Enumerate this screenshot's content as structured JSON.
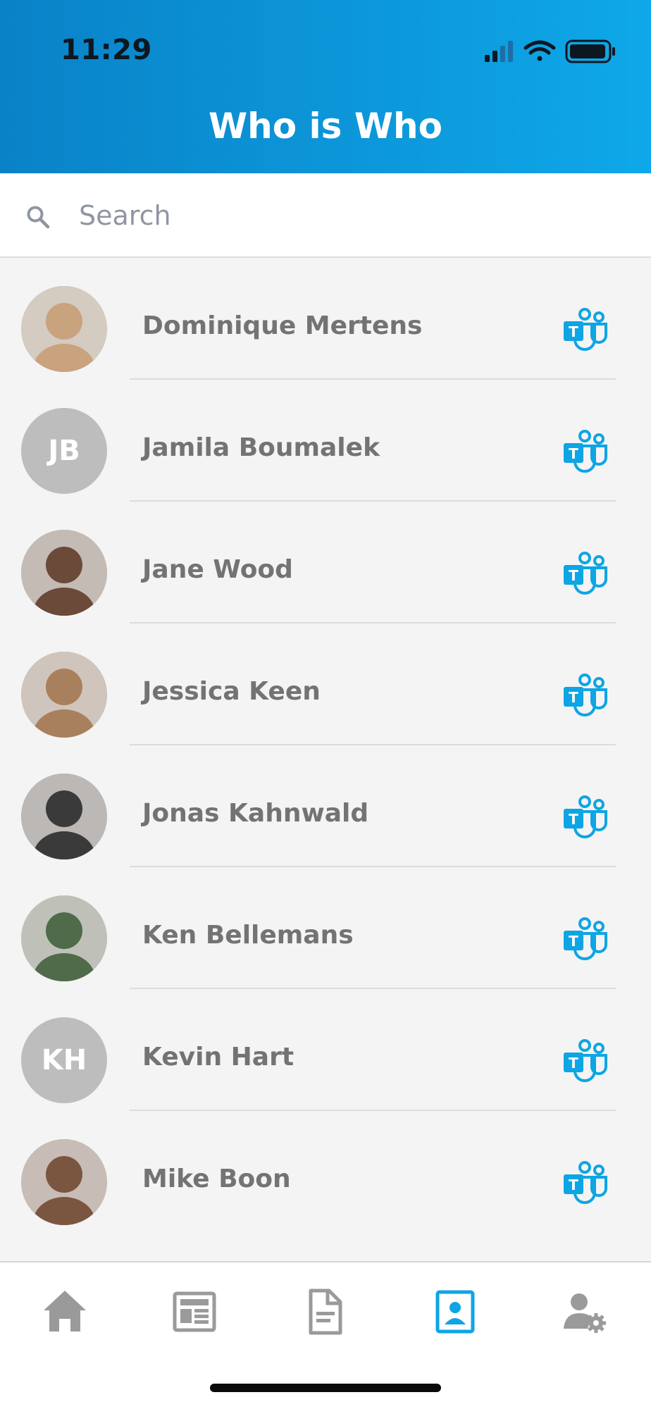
{
  "status_bar": {
    "time": "11:29"
  },
  "header": {
    "title": "Who is Who"
  },
  "search": {
    "placeholder": "Search"
  },
  "contacts": [
    {
      "name": "Dominique Mertens",
      "initials": "",
      "photo": "photo",
      "photo_bg": "#c9a27e"
    },
    {
      "name": "Jamila Boumalek",
      "initials": "JB",
      "photo": "",
      "photo_bg": "#bdbdbd"
    },
    {
      "name": "Jane Wood",
      "initials": "",
      "photo": "photo",
      "photo_bg": "#6b4a3a"
    },
    {
      "name": "Jessica Keen",
      "initials": "",
      "photo": "photo",
      "photo_bg": "#a9805e"
    },
    {
      "name": "Jonas Kahnwald",
      "initials": "",
      "photo": "photo",
      "photo_bg": "#3a3a3a"
    },
    {
      "name": "Ken Bellemans",
      "initials": "",
      "photo": "photo",
      "photo_bg": "#4f6b4a"
    },
    {
      "name": "Kevin Hart",
      "initials": "KH",
      "photo": "",
      "photo_bg": "#bdbdbd"
    },
    {
      "name": "Mike Boon",
      "initials": "",
      "photo": "photo",
      "photo_bg": "#7a5640"
    }
  ],
  "tabs": [
    {
      "icon": "home-icon",
      "active": false
    },
    {
      "icon": "news-icon",
      "active": false
    },
    {
      "icon": "document-icon",
      "active": false
    },
    {
      "icon": "contacts-icon",
      "active": true
    },
    {
      "icon": "user-settings-icon",
      "active": false
    }
  ],
  "colors": {
    "accent": "#0ea5e4",
    "tab_inactive": "#9a9a9a",
    "name_text": "#737373"
  }
}
